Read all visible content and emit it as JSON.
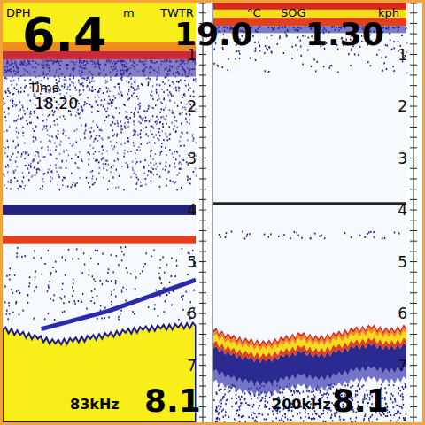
{
  "readouts": [
    {
      "label": "DPH",
      "value": "6.4",
      "unit": "m"
    },
    {
      "label": "TWTR",
      "value": "19.0",
      "unit": "°C"
    },
    {
      "label": "SOG",
      "value": "1.30",
      "unit": "kph"
    }
  ],
  "time": {
    "label": "Time",
    "value": "18:20"
  },
  "panels": [
    {
      "frequency": "83kHz",
      "range": "8.1",
      "kind": "filled",
      "surface_depth": 1.1,
      "scale": [
        "1",
        "2",
        "3",
        "4",
        "5",
        "6",
        "7"
      ],
      "bottom_depth": [
        6.32,
        6.41,
        6.49,
        6.58,
        6.54,
        6.49,
        6.44,
        6.37,
        6.32,
        6.29,
        6.27,
        6.24
      ],
      "layers": [
        {
          "depth": 3.9,
          "thickness": 0.2,
          "color": "#23237a"
        },
        {
          "depth": 4.5,
          "thickness": 0.16,
          "color": "#e0401c"
        }
      ],
      "target_line": [
        [
          0.2,
          6.3
        ],
        [
          0.55,
          5.95
        ],
        [
          1.0,
          5.35
        ]
      ]
    },
    {
      "frequency": "200kHz",
      "range": "8.1",
      "kind": "banded",
      "surface_depth": 0.45,
      "scale": [
        "1",
        "2",
        "3",
        "4",
        "5",
        "6",
        "7"
      ],
      "bottom_depth": [
        6.32,
        6.46,
        6.54,
        6.58,
        6.49,
        6.41,
        6.49,
        6.41,
        6.32,
        6.27,
        6.34,
        6.27
      ],
      "layers": [
        {
          "depth": 3.85,
          "thickness": 0.05,
          "color": "#222222"
        }
      ],
      "target_line": []
    }
  ]
}
